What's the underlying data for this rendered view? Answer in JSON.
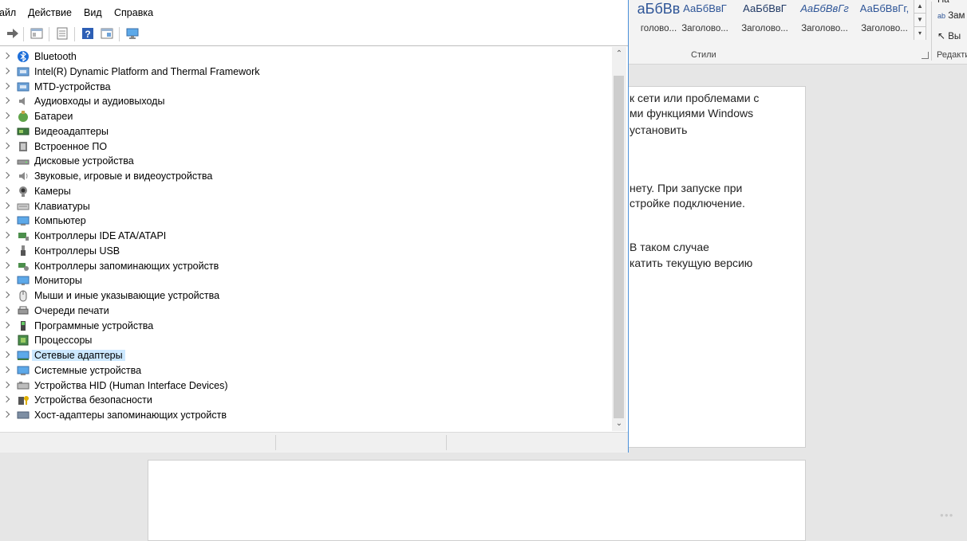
{
  "word": {
    "styles": [
      {
        "sample": "аБбВв",
        "name": "голово..."
      },
      {
        "sample": "АаБбВвГ",
        "name": "Заголово..."
      },
      {
        "sample": "АаБбВвГ",
        "name": "Заголово..."
      },
      {
        "sample": "АаБбВвГг",
        "name": "Заголово..."
      },
      {
        "sample": "АаБбВвГг,",
        "name": "Заголово..."
      }
    ],
    "styles_group_label": "Стили",
    "edit_items": [
      "На",
      "Зам",
      "Вы"
    ],
    "edit_group_label": "Редакти",
    "doc_lines": [
      "к сети или проблемами с",
      "ми функциями Windows",
      "установить",
      "нету. При запуске при",
      "стройке подключение.",
      "В таком случае",
      "катить текущую версию"
    ],
    "watermark": "●●●"
  },
  "device_manager": {
    "menu": [
      "айл",
      "Действие",
      "Вид",
      "Справка"
    ],
    "toolbar_icons": [
      "forward-arrow-icon",
      "properties-icon",
      "list-icon",
      "help-icon",
      "details-icon",
      "monitor-icon"
    ],
    "tree_items": [
      {
        "label": "Bluetooth",
        "icon": "bluetooth-icon"
      },
      {
        "label": "Intel(R) Dynamic Platform and Thermal Framework",
        "icon": "intel-platform-icon"
      },
      {
        "label": "MTD-устройства",
        "icon": "mtd-icon"
      },
      {
        "label": "Аудиовходы и аудиовыходы",
        "icon": "audio-io-icon"
      },
      {
        "label": "Батареи",
        "icon": "battery-icon"
      },
      {
        "label": "Видеоадаптеры",
        "icon": "display-adapter-icon"
      },
      {
        "label": "Встроенное ПО",
        "icon": "firmware-icon"
      },
      {
        "label": "Дисковые устройства",
        "icon": "disk-drive-icon"
      },
      {
        "label": "Звуковые, игровые и видеоустройства",
        "icon": "sound-icon"
      },
      {
        "label": "Камеры",
        "icon": "camera-icon"
      },
      {
        "label": "Клавиатуры",
        "icon": "keyboard-icon"
      },
      {
        "label": "Компьютер",
        "icon": "computer-icon"
      },
      {
        "label": "Контроллеры IDE ATA/ATAPI",
        "icon": "ide-controller-icon"
      },
      {
        "label": "Контроллеры USB",
        "icon": "usb-icon"
      },
      {
        "label": "Контроллеры запоминающих устройств",
        "icon": "storage-controller-icon"
      },
      {
        "label": "Мониторы",
        "icon": "monitor-icon"
      },
      {
        "label": "Мыши и иные указывающие устройства",
        "icon": "mouse-icon"
      },
      {
        "label": "Очереди печати",
        "icon": "printer-icon"
      },
      {
        "label": "Программные устройства",
        "icon": "software-device-icon"
      },
      {
        "label": "Процессоры",
        "icon": "processor-icon"
      },
      {
        "label": "Сетевые адаптеры",
        "icon": "network-adapter-icon",
        "selected": true
      },
      {
        "label": "Системные устройства",
        "icon": "system-device-icon"
      },
      {
        "label": "Устройства HID (Human Interface Devices)",
        "icon": "hid-icon"
      },
      {
        "label": "Устройства безопасности",
        "icon": "security-device-icon"
      },
      {
        "label": "Хост-адаптеры запоминающих устройств",
        "icon": "storage-host-icon"
      }
    ]
  }
}
